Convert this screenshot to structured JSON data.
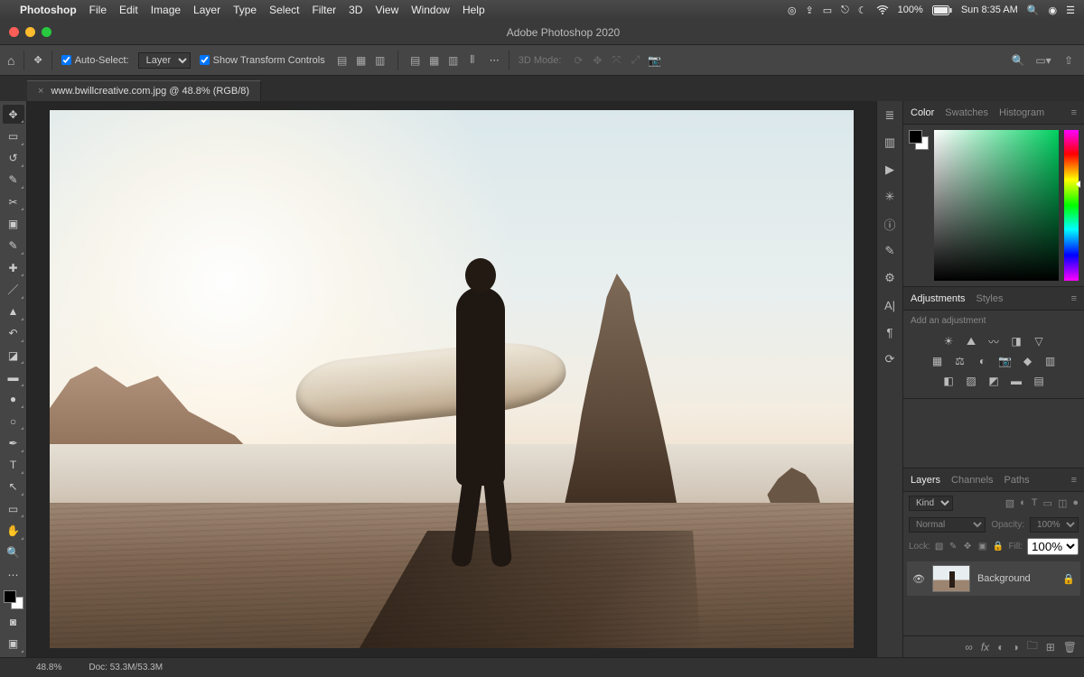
{
  "menubar": {
    "app_name": "Photoshop",
    "items": [
      "File",
      "Edit",
      "Image",
      "Layer",
      "Type",
      "Select",
      "Filter",
      "3D",
      "View",
      "Window",
      "Help"
    ],
    "battery": "100%",
    "clock": "Sun 8:35 AM"
  },
  "titlebar": {
    "title": "Adobe Photoshop 2020"
  },
  "traffic_colors": {
    "close": "#ff5f57",
    "min": "#febc2e",
    "max": "#28c840"
  },
  "optbar": {
    "auto_select_label": "Auto-Select:",
    "auto_select_value": "Layer",
    "show_transform": "Show Transform Controls",
    "mode_label": "3D Mode:"
  },
  "tab": {
    "name": "www.bwillcreative.com.jpg @ 48.8% (RGB/8)"
  },
  "panels": {
    "color_tabs": [
      "Color",
      "Swatches",
      "Histogram"
    ],
    "adjust_tabs": [
      "Adjustments",
      "Styles"
    ],
    "adjust_sub": "Add an adjustment",
    "layers_tabs": [
      "Layers",
      "Channels",
      "Paths"
    ],
    "kind_label": "Kind",
    "blend_mode": "Normal",
    "opacity_label": "Opacity:",
    "opacity_val": "100%",
    "lock_label": "Lock:",
    "fill_label": "Fill:",
    "fill_val": "100%",
    "layer_name": "Background"
  },
  "status": {
    "zoom": "48.8%",
    "doc": "Doc: 53.3M/53.3M"
  }
}
